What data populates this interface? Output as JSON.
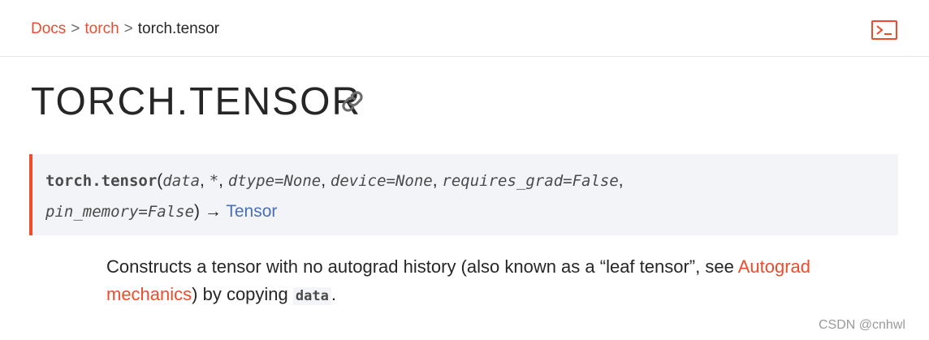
{
  "breadcrumb": {
    "items": [
      "Docs",
      "torch"
    ],
    "current": "torch.tensor",
    "separator": ">"
  },
  "header": {
    "shell_icon": "terminal-icon",
    "link_icon": "link-icon"
  },
  "page": {
    "title": "TORCH.TENSOR"
  },
  "signature": {
    "function_name": "torch.tensor",
    "open_paren": "(",
    "params": [
      "data",
      "*",
      "dtype=None",
      "device=None",
      "requires_grad=False",
      "pin_memory=False"
    ],
    "close_paren": ")",
    "arrow": "→",
    "return_type": "Tensor"
  },
  "description": {
    "text_before": "Constructs a tensor with no autograd history (also known as a “leaf tensor”, see ",
    "link": "Autograd mechanics",
    "text_after": ") by copying ",
    "code": "data",
    "end": "."
  },
  "watermark": "CSDN @cnhwl",
  "colors": {
    "accent": "#ee4c2c",
    "link_blue": "#4a6fb5",
    "signature_bg": "#f3f4f7"
  }
}
